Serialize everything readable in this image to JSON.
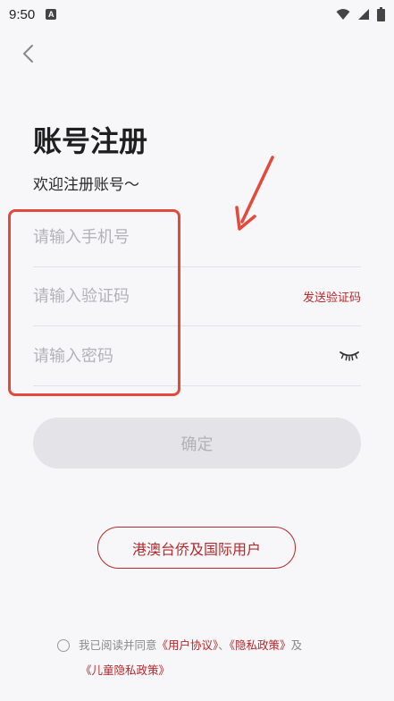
{
  "status_bar": {
    "time": "9:50",
    "notification_letter": "A"
  },
  "page": {
    "title": "账号注册",
    "subtitle": "欢迎注册账号～"
  },
  "form": {
    "phone_placeholder": "请输入手机号",
    "code_placeholder": "请输入验证码",
    "send_code_label": "发送验证码",
    "password_placeholder": "请输入密码"
  },
  "buttons": {
    "confirm_label": "确定",
    "intl_users_label": "港澳台侨及国际用户"
  },
  "agreement": {
    "prefix": "我已阅读并同意",
    "user_agreement": "《用户协议》",
    "separator": "、",
    "privacy_policy": "《隐私政策》",
    "and": "及",
    "children_privacy": "《儿童隐私政策》"
  },
  "colors": {
    "accent": "#b8282b",
    "annotation": "#e24a3b",
    "background": "#f7f6f8"
  }
}
